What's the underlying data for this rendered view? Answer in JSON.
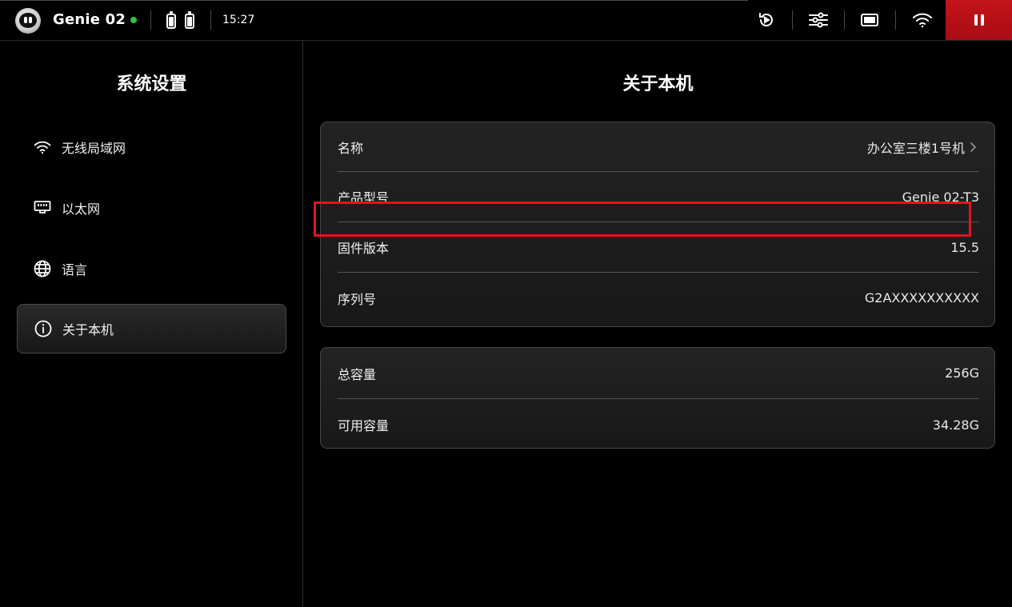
{
  "topbar": {
    "device_name": "Genie 02",
    "connection_status_color": "#27c54a",
    "time": "15:27",
    "icons": [
      "robot-logo-icon",
      "status-dot-icon",
      "battery-icon",
      "battery-icon",
      "replay-icon",
      "sliders-icon",
      "screen-icon",
      "wifi-icon",
      "pause-icon"
    ],
    "pause_button_color": "#c4141b"
  },
  "sidebar": {
    "title": "系统设置",
    "items": [
      {
        "label": "无线局域网",
        "icon": "wifi-icon",
        "active": false
      },
      {
        "label": "以太网",
        "icon": "ethernet-icon",
        "active": false
      },
      {
        "label": "语言",
        "icon": "globe-icon",
        "active": false
      },
      {
        "label": "关于本机",
        "icon": "info-icon",
        "active": true
      }
    ]
  },
  "main": {
    "title": "关于本机",
    "info_rows": [
      {
        "key": "名称",
        "value": "办公室三楼1号机",
        "has_chevron": true
      },
      {
        "key": "产品型号",
        "value": "Genie 02-T3"
      },
      {
        "key": "固件版本",
        "value": "15.5"
      },
      {
        "key": "序列号",
        "value": "G2AXXXXXXXXXX",
        "highlighted": true
      }
    ],
    "storage_rows": [
      {
        "key": "总容量",
        "value": "256G"
      },
      {
        "key": "可用容量",
        "value": "34.28G"
      }
    ],
    "highlight_color": "#e0161c"
  }
}
